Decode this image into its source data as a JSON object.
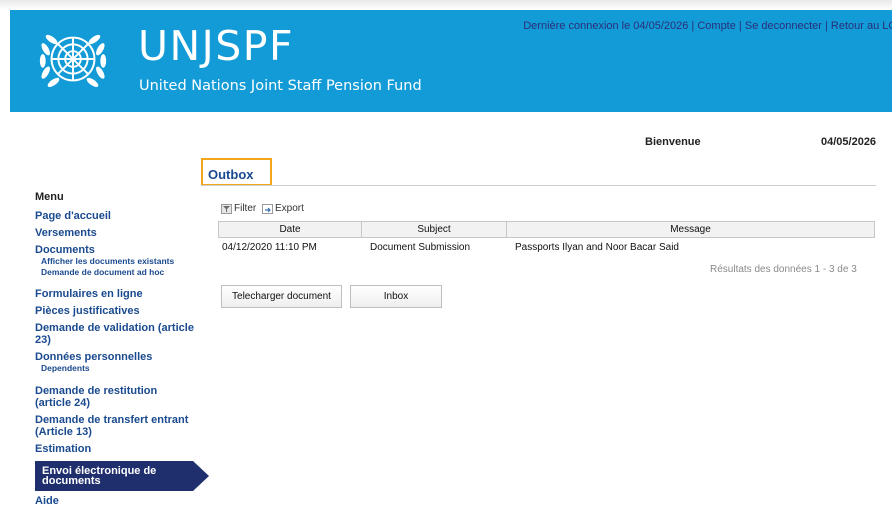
{
  "header": {
    "brand": "UNJSPF",
    "brand_subtitle": "United Nations Joint Staff Pension Fund",
    "last_login": "Dernière connexion le 04/05/2026",
    "account": "Compte",
    "logout": "Se deconnecter",
    "back": "Retour au LOI",
    "separator": " | "
  },
  "welcome": {
    "label": "Bienvenue",
    "date": "04/05/2026"
  },
  "sidebar": {
    "menu_title": "Menu",
    "items": [
      {
        "label": "Page d'accueil"
      },
      {
        "label": "Versements"
      },
      {
        "label": "Documents",
        "subs": [
          "Afficher les documents existants",
          "Demande de document ad hoc"
        ]
      },
      {
        "label": "Formulaires en ligne"
      },
      {
        "label": "Pièces justificatives"
      },
      {
        "label": "Demande de validation (article 23)"
      },
      {
        "label": "Données personnelles",
        "subs": [
          "Dependents"
        ]
      },
      {
        "label": "Demande de restitution (article 24)"
      },
      {
        "label": "Demande de transfert entrant (Article 13)"
      },
      {
        "label": "Estimation"
      },
      {
        "label": "Envoi électronique de documents",
        "active": true
      },
      {
        "label": "Aide"
      }
    ]
  },
  "main": {
    "title": "Outbox",
    "tools": {
      "filter": "Filter",
      "export": "Export"
    },
    "columns": [
      "Date",
      "Subject",
      "Message"
    ],
    "rows": [
      [
        "04/12/2020 11:10 PM",
        "Document Submission",
        "Passports Ilyan and Noor Bacar Said"
      ]
    ],
    "results": "Résultats des données 1 - 3 de 3",
    "buttons": {
      "upload": "Telecharger document",
      "inbox": "Inbox"
    }
  },
  "colors": {
    "header_bg": "#129bd6",
    "nav_link": "#1a4a8f",
    "active_bg": "#1f2f6e",
    "highlight": "#f2a71b"
  },
  "icons": {
    "emblem": "un-emblem-icon",
    "filter": "filter-icon",
    "export": "export-icon"
  }
}
